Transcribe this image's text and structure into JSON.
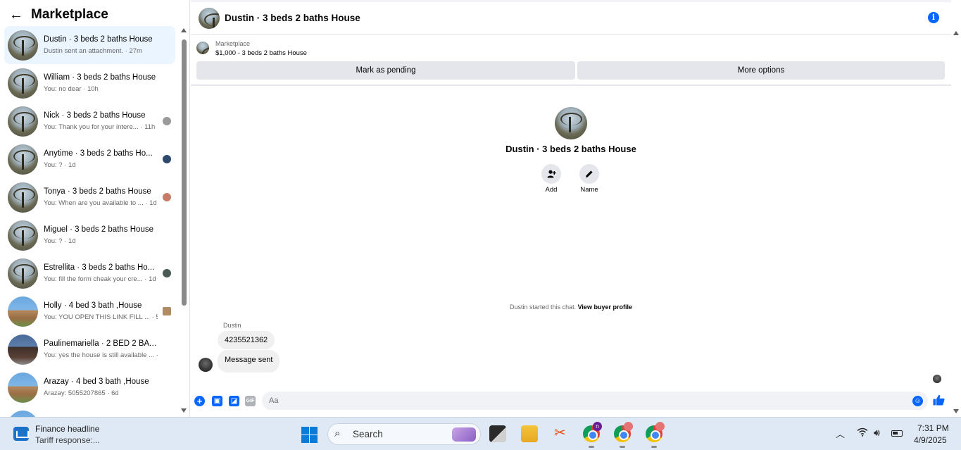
{
  "sidebar": {
    "title": "Marketplace",
    "conversations": [
      {
        "name": "Dustin · 3 beds 2 baths House",
        "snippet": "Dustin sent an attachment. · 27m"
      },
      {
        "name": "William · 3 beds 2 baths House",
        "snippet": "You: no dear · 10h"
      },
      {
        "name": "Nick · 3 beds 2 baths House",
        "snippet": "You: Thank you for your intere...  · 11h"
      },
      {
        "name": "Anytime · 3 beds 2 baths Ho...",
        "snippet": "You: ? · 1d"
      },
      {
        "name": "Tonya · 3 beds 2 baths House",
        "snippet": "You: When are you available to ...  · 1d"
      },
      {
        "name": "Miguel · 3 beds 2 baths House",
        "snippet": "You: ? · 1d"
      },
      {
        "name": "Estrellita · 3 beds 2 baths Ho...",
        "snippet": "You: fill the form cheak your cre...  · 1d"
      },
      {
        "name": "Holly · 4 bed 3 bath ,House",
        "snippet": "You: YOU OPEN THIS LINK FILL ...  · 5d"
      },
      {
        "name": "Paulinemariella · 2 BED 2 BATH ...",
        "snippet": "You: yes the house is still available ...  · 5d"
      },
      {
        "name": "Arazay · 4 bed 3 bath ,House",
        "snippet": "Arazay: 5055207865 · 6d"
      }
    ]
  },
  "chat": {
    "title": "Dustin · 3 beds 2 baths House",
    "marketplace_label": "Marketplace",
    "listing": "$1,000 - 3 beds 2 baths House",
    "mark_pending_label": "Mark as pending",
    "more_options_label": "More options",
    "profile_name": "Dustin · 3 beds 2 baths House",
    "add_label": "Add",
    "name_label": "Name",
    "started_text": "Dustin started this chat.",
    "view_profile_label": "View buyer profile",
    "sender_name": "Dustin",
    "messages": [
      "4235521362",
      "Message sent"
    ],
    "input_placeholder": "Aa",
    "gif_label": "GIF"
  },
  "taskbar": {
    "news_title": "Finance headline",
    "news_sub": "Tariff response:...",
    "search_label": "Search",
    "badge_1": "n",
    "time": "7:31 PM",
    "date": "4/9/2025"
  },
  "colors": {
    "accent": "#0866ff",
    "active_row": "#ebf5ff",
    "button_bg": "#e4e6eb"
  }
}
